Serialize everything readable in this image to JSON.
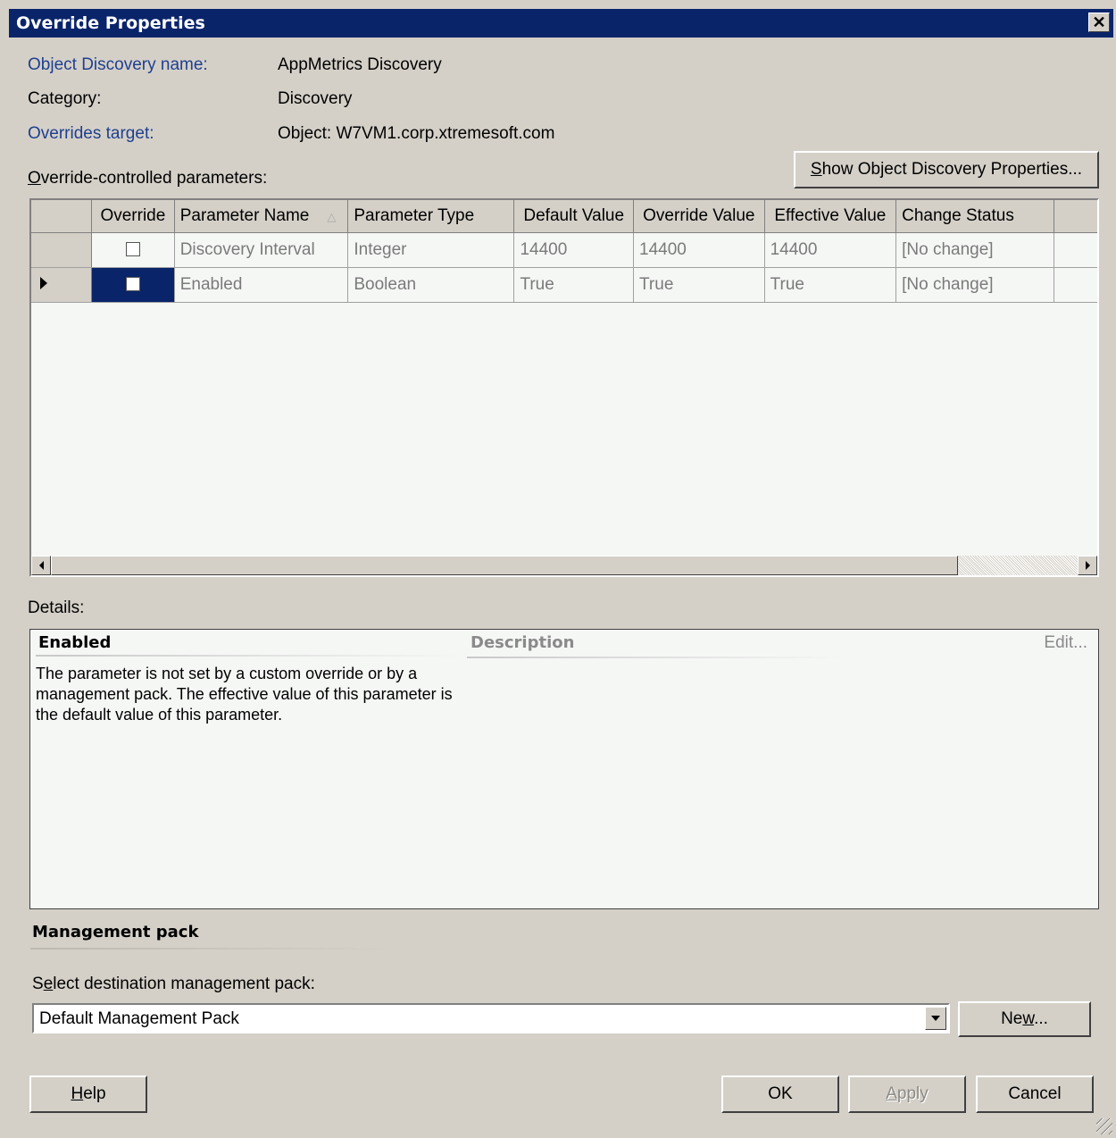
{
  "window": {
    "title": "Override Properties",
    "close_glyph": "✕"
  },
  "info": {
    "object_discovery_name_label": "Object Discovery name:",
    "object_discovery_name_value": "AppMetrics Discovery",
    "category_label": "Category:",
    "category_value": "Discovery",
    "overrides_target_label": "Overrides target:",
    "overrides_target_value": "Object: W7VM1.corp.xtremesoft.com"
  },
  "params": {
    "label_pre": "",
    "label_accel": "O",
    "label_post": "verride-controlled parameters:",
    "show_btn_pre": "",
    "show_btn_accel": "S",
    "show_btn_post": "how Object Discovery Properties..."
  },
  "grid": {
    "columns": [
      "Override",
      "Parameter Name",
      "Parameter Type",
      "Default Value",
      "Override Value",
      "Effective Value",
      "Change Status"
    ],
    "rows": [
      {
        "override": false,
        "name": "Discovery Interval",
        "type": "Integer",
        "default": "14400",
        "override_value": "14400",
        "effective": "14400",
        "status": "[No change]",
        "current": false
      },
      {
        "override": false,
        "name": "Enabled",
        "type": "Boolean",
        "default": "True",
        "override_value": "True",
        "effective": "True",
        "status": "[No change]",
        "current": true
      }
    ]
  },
  "details": {
    "label": "Details:",
    "parameter_name": "Enabled",
    "description_title": "Description",
    "edit_link": "Edit...",
    "text": "The parameter is not set by a custom override or by a management pack. The effective value of this parameter is the default value of this parameter."
  },
  "management_pack": {
    "title": "Management pack",
    "select_label_pre": "S",
    "select_label_accel": "e",
    "select_label_post": "lect destination management pack:",
    "selected": "Default Management Pack",
    "new_btn_pre": "Ne",
    "new_btn_accel": "w",
    "new_btn_post": "..."
  },
  "buttons": {
    "help_pre": "",
    "help_accel": "H",
    "help_post": "elp",
    "ok": "OK",
    "apply_pre": "",
    "apply_accel": "A",
    "apply_post": "pply",
    "cancel": "Cancel"
  },
  "icons": {
    "close": "close-icon",
    "sort": "sort-ascending-icon",
    "row_pointer": "row-pointer-icon",
    "scroll_left": "scroll-left-icon",
    "scroll_right": "scroll-right-icon",
    "dropdown": "chevron-down-icon",
    "resize": "resize-grip-icon"
  }
}
